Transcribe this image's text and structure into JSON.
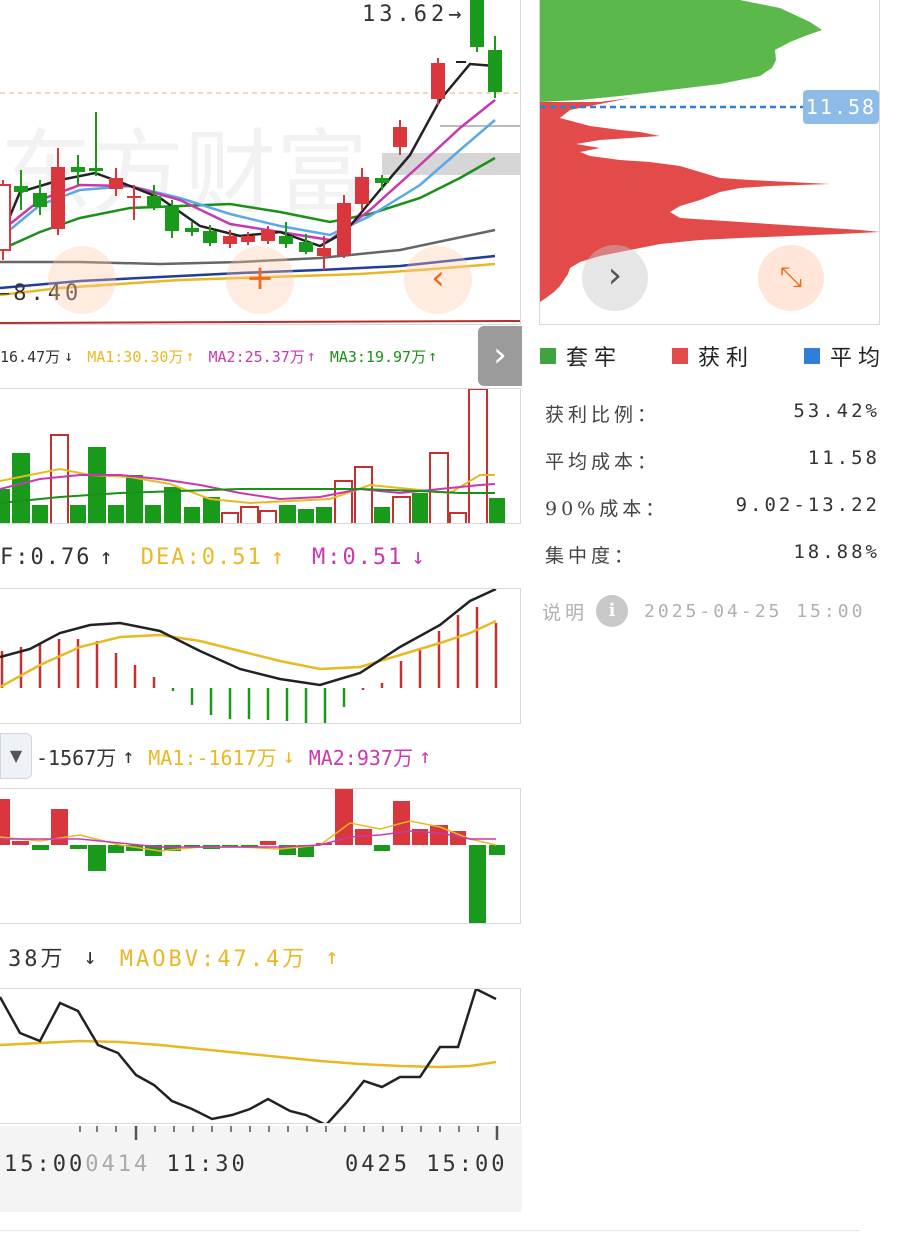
{
  "price_chart": {
    "high_label": "13.62",
    "low_label": "8.40",
    "watermark": "东方财富"
  },
  "volume_header": {
    "vol": "16.47万",
    "vol_arrow": "↓",
    "ma1": "MA1:30.30万",
    "ma1_arrow": "↑",
    "ma2": "MA2:25.37万",
    "ma2_arrow": "↑",
    "ma3": "MA3:19.97万",
    "ma3_arrow": "↑"
  },
  "macd_header": {
    "dif": "F:0.76",
    "dif_arrow": "↑",
    "dea": "DEA:0.51",
    "dea_arrow": "↑",
    "m": "M:0.51",
    "m_arrow": "↓"
  },
  "fund_header": {
    "main": "-1567万",
    "main_arrow": "↑",
    "ma1": "MA1:-1617万",
    "ma1_arrow": "↓",
    "ma2": "MA2:937万",
    "ma2_arrow": "↑"
  },
  "obv_header": {
    "obv": "38万",
    "obv_arrow": "↓",
    "maobv": "MAOBV:47.4万",
    "maobv_arrow": "↑"
  },
  "time_axis": {
    "left": "15:00",
    "mid_date": "0414",
    "mid_time": "11:30",
    "right_date": "0425",
    "right_time": "15:00"
  },
  "chip": {
    "avg_cost_tag": "11.58",
    "legend": {
      "trapped": "套牢",
      "profit": "获利",
      "average": "平均"
    },
    "stats": [
      {
        "label": "获利比例：",
        "value": "53.42%"
      },
      {
        "label": "平均成本：",
        "value": "11.58"
      },
      {
        "label": "90%成本：",
        "value": "9.02-13.22"
      },
      {
        "label": "集中度：",
        "value": "18.88%"
      }
    ],
    "note_label": "说明",
    "timestamp": "2025-04-25 15:00"
  },
  "colors": {
    "up": "#d9363e",
    "down": "#1a9a1a",
    "profit": "#e34a4a",
    "trapped": "#5bb84a",
    "average": "#2f7fd8",
    "ma_yellow": "#e8b923",
    "ma_magenta": "#c839b0",
    "ma_green": "#1a8f1a",
    "ma_blue": "#5aa9e6",
    "nav_orange": "#f06a1a"
  }
}
